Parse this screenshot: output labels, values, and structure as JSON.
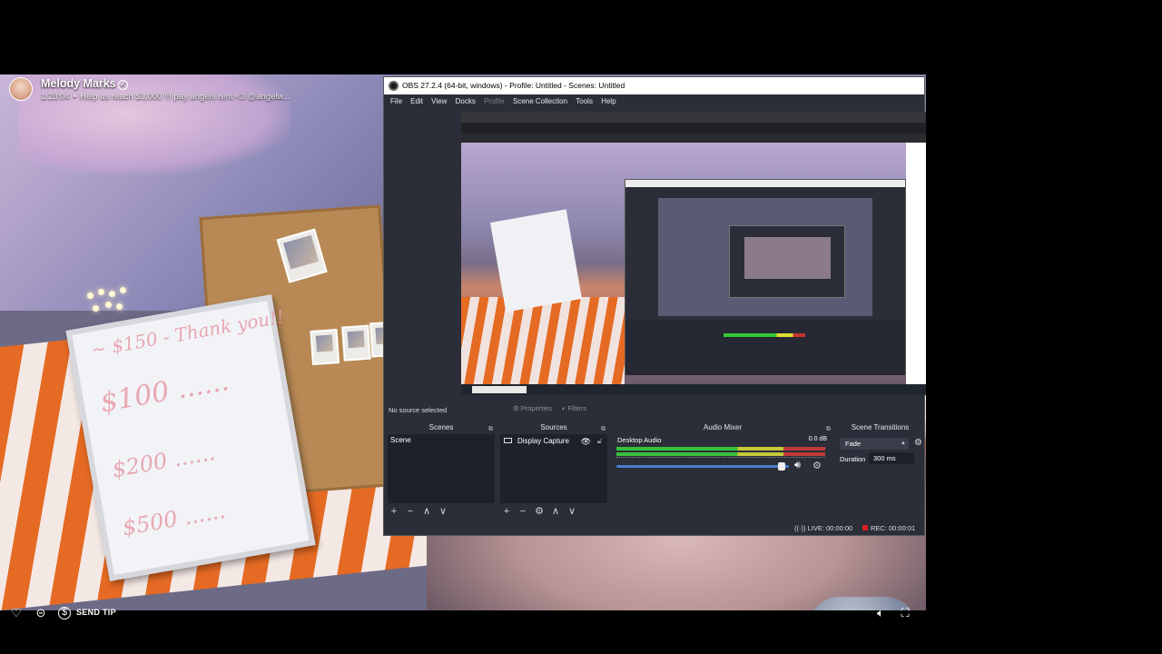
{
  "stream": {
    "streamer_name": "Melody Marks",
    "elapsed": "1:23:04",
    "goal_text": "Help us reach $3,000 !!! pay angels rent <3 @angelw...",
    "whiteboard_lines": [
      "~ $150 - Thank you!!",
      "$100 ......",
      "$200 ......",
      "$500 ......"
    ]
  },
  "controls": {
    "send_tip_label": "SEND TIP",
    "icons": [
      "heart-icon",
      "chat-icon",
      "dollar-icon",
      "volume-icon",
      "fullscreen-icon"
    ]
  },
  "obs": {
    "title": "OBS 27.2.4 (64-bit, windows) - Profile: Untitled - Scenes: Untitled",
    "menu": [
      "File",
      "Edit",
      "View",
      "Docks",
      "Profile",
      "Scene Collection",
      "Tools",
      "Help"
    ],
    "menu_disabled": [
      "Profile"
    ],
    "no_source_text": "No source selected",
    "properties_label": "Properties",
    "filters_label": "Filters",
    "docks": {
      "scenes": {
        "title": "Scenes",
        "items": [
          "Scene"
        ]
      },
      "sources": {
        "title": "Sources",
        "items": [
          "Display Capture"
        ]
      },
      "mixer": {
        "title": "Audio Mixer",
        "track_name": "Desktop Audio",
        "db_value": "0.0 dB"
      },
      "transitions": {
        "title": "Scene Transitions",
        "selected": "Fade",
        "duration_label": "Duration",
        "duration_value": "300 ms"
      }
    },
    "toolbar_symbols": {
      "add": "+",
      "remove": "−",
      "up": "∧",
      "down": "∨",
      "settings": "⚙"
    },
    "status": {
      "live": "LIVE: 00:00:00",
      "rec": "REC: 00:00:01"
    }
  },
  "colors": {
    "obs_bg": "#2b2e38",
    "rec_red": "#d82020",
    "vu_green": "#38c03a",
    "slider_blue": "#4a7fd0"
  }
}
